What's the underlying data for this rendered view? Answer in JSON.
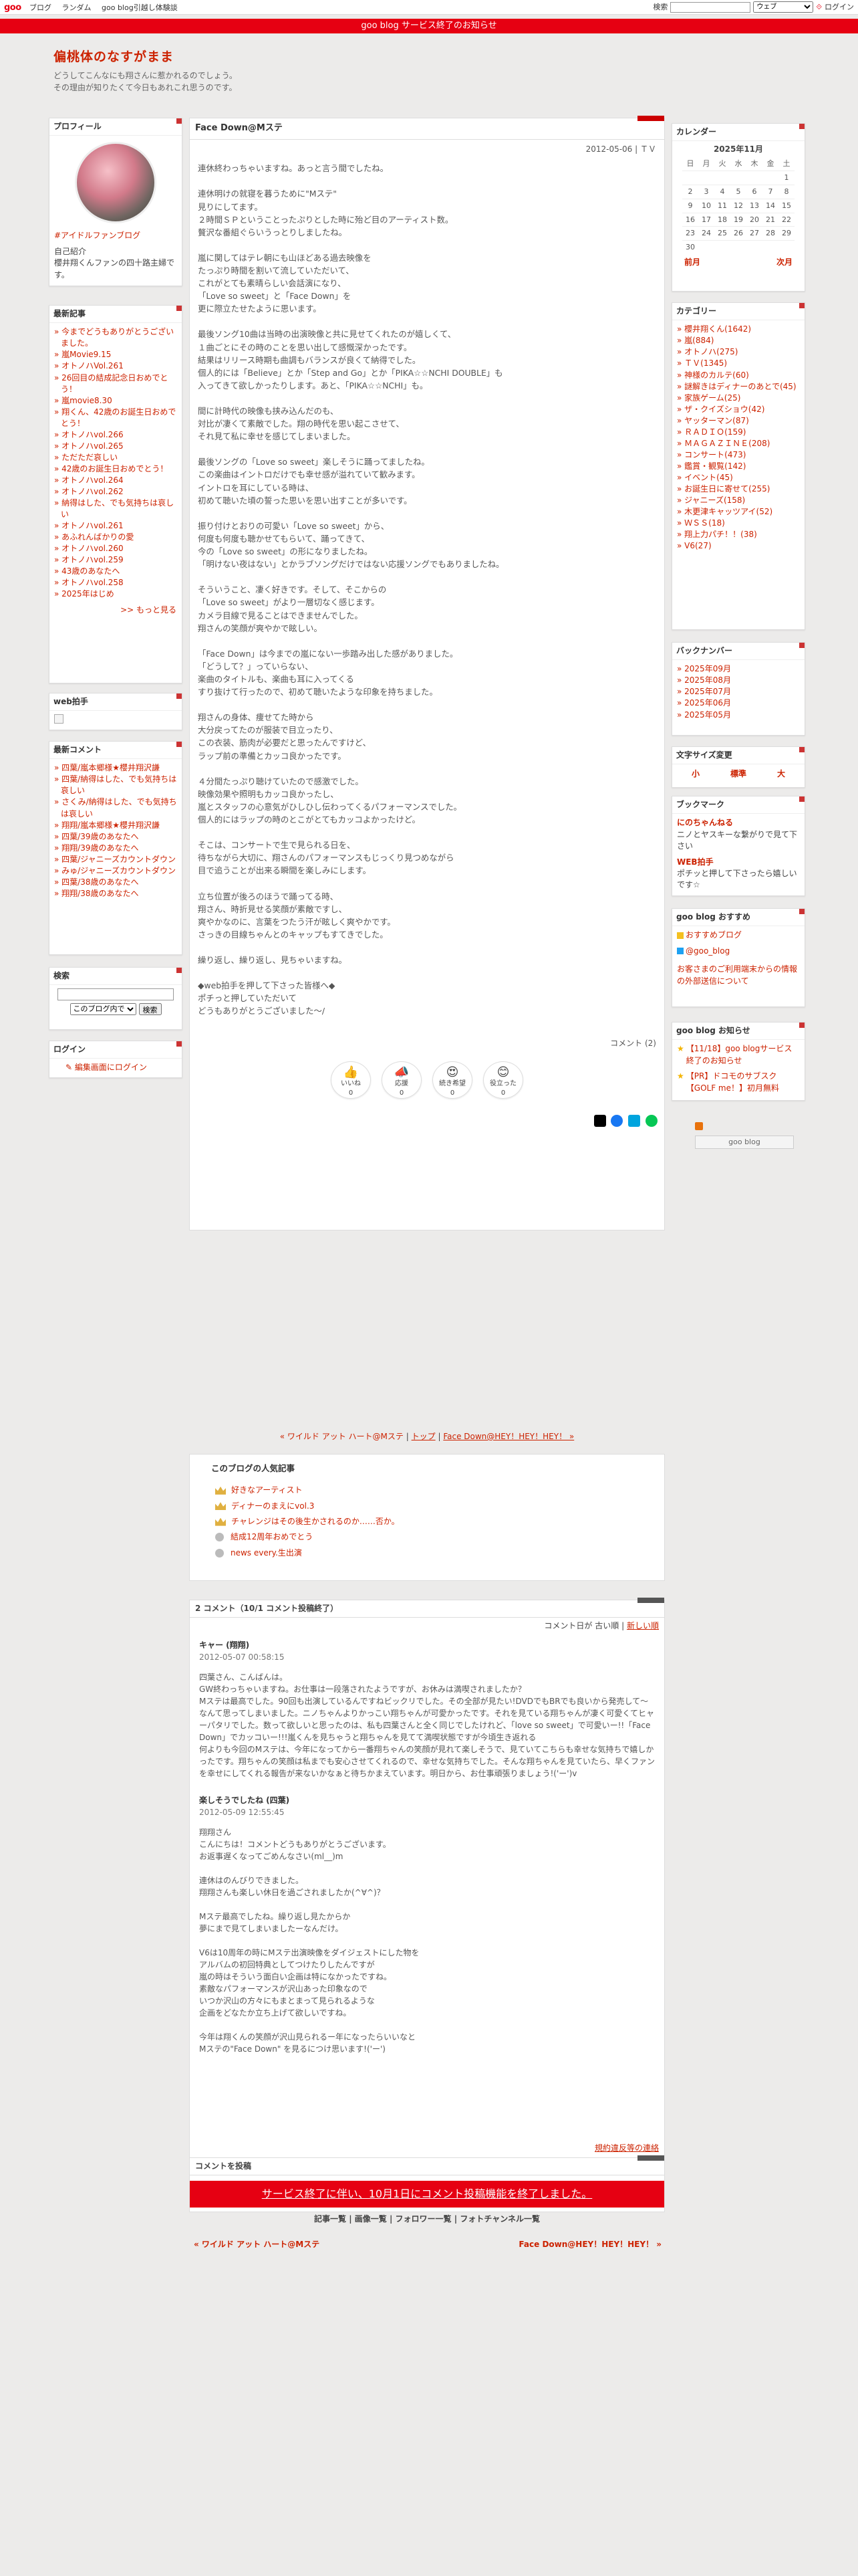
{
  "topbar": {
    "logo": "goo",
    "nav": [
      "ブログ",
      "ランダム",
      "goo blog引越し体験談"
    ],
    "search_label": "検索",
    "search_select": "ウェブ",
    "login": "ログイン"
  },
  "notice": "goo blog サービス終了のお知らせ",
  "header": {
    "title": "偏桃体のなすがまま",
    "desc1": "どうしてこんなにも翔さんに惹かれるのでしょう。",
    "desc2": "その理由が知りたくて今日もあれこれ思うのです。"
  },
  "profile": {
    "heading": "プロフィール",
    "link": "#アイドルファンブログ",
    "intro_label": "自己紹介",
    "intro": "櫻井翔くんファンの四十路主婦です。"
  },
  "recent": {
    "heading": "最新記事",
    "items": [
      "今までどうもありがとうございました。",
      "嵐Movie9.15",
      "オトノハVol.261",
      "26回目の結成記念日おめでとう！",
      "嵐movie8.30",
      "翔くん、42歳のお誕生日おめでとう！",
      "オトノハvol.266",
      "オトノハvol.265",
      "ただただ哀しい",
      "42歳のお誕生日おめでとう！",
      "オトノハvol.264",
      "オトノハvol.262",
      "納得はした、でも気持ちは哀しい",
      "オトノハvol.261",
      "あふれんばかりの愛",
      "オトノハvol.260",
      "オトノハvol.259",
      "43歳のあなたへ",
      "オトノハvol.258",
      "2025年はじめ"
    ],
    "more": ">> もっと見る"
  },
  "webtecho": {
    "heading": "web拍手"
  },
  "comments_recent": {
    "heading": "最新コメント",
    "items": [
      "四葉/嵐本郷様★櫻井翔沢謙",
      "四葉/納得はした、でも気持ちは哀しい",
      "さくみ/納得はした、でも気持ちは哀しい",
      "翔翔/嵐本郷様★櫻井翔沢謙",
      "四葉/39歳のあなたへ",
      "翔翔/39歳のあなたへ",
      "四葉/ジャニーズカウントダウン",
      "みゅ/ジャニーズカウントダウン",
      "四葉/38歳のあなたへ",
      "翔翔/38歳のあなたへ"
    ]
  },
  "search": {
    "heading": "検索",
    "select": "このブログ内で",
    "button": "検索"
  },
  "login": {
    "heading": "ログイン",
    "link": "編集画面にログイン"
  },
  "entry": {
    "title": "Face Down@Mステ",
    "date": "2012-05-06 | ＴＶ",
    "body": "連休終わっちゃいますね。あっと言う間でしたね。\n\n連休明けの就寝を暮うために\"Mステ\"\n見りにしてます。\n２時間ＳＰということったぷりとした時に殆ど目のアーティスト数。\n贅沢な番組ぐらいうっとりしましたね。\n\n嵐に関してはテレ朝にも山ほどある過去映像を\nたっぷり時間を割いて流していただいて、\nこれがとても素晴らしい会話演になり、\n「Love so sweet」と「Face Down」を\n更に際立たせたように思います。\n\n最後ソング10曲は当時の出演映像と共に見せてくれたのが嬉しくて、\n１曲ごとにその時のことを思い出して感慨深かったです。\n結果はリリース時期も曲調もバランスが良くて納得でした。\n個人的には「Believe」とか「Step and Go」とか「PIKA☆☆NCHI DOUBLE」も\n入ってきて欲しかったりします。あと、「PIKA☆☆NCHI」も。\n\n間に計時代の映像も挟み込んだのも、\n対比が凄くて素敵でした。翔の時代を思い起こさせて、\nそれ見て私に幸せを感じてしまいました。\n\n最後ソングの「Love so sweet」楽しそうに踊ってましたね。\nこの楽曲はイントロだけでも幸せ感が溢れていて歓みます。\nイントロを耳にしている時は、\n初めて聴いた頃の誓った思いを思い出すことが多いです。\n\n振り付けとおりの可愛い「Love so sweet」から、\n何度も何度も聴かせてもらいて、踊ってきて、\n今の「Love so sweet」の形になりましたね。\n「明けない夜はない」とかラブソングだけではない応援ソングでもありましたね。\n\nそういうこと、凄く好きです。そして、そこからの\n「Love so sweet」がより一層切なく感じます。\nカメラ目線で見ることはできませんでした。\n翔さんの笑顔が爽やかで眩しい。\n\n「Face Down」は今までの嵐にない一歩踏み出した感がありました。\n「どうして？」っていらない、\n楽曲のタイトルも、楽曲も耳に入ってくる\nすり抜けて行ったので、初めて聴いたような印象を持ちました。\n\n翔さんの身体、痩せてた時から\n大分戻ってたのが服装で目立ったり、\nこの衣装、筋肉が必要だと思ったんですけど、\nラップ前の準備とカッコ良かったです。\n\n４分間たっぷり聴けていたので感激でした。\n映像効果や照明もカッコ良かったし、\n嵐とスタッフの心意気がひしひし伝わってくるパフォーマンスでした。\n個人的にはラップの時のとこがとてもカッコよかったけど。\n\nそこは、コンサートで生で見られる日を、\n待ちながら大切に、翔さんのパフォーマンスもじっくり見つめながら\n目で追うことが出来る瞬間を楽しみにします。\n\n立ち位置が後ろのほうで踊ってる時、\n翔さん、時折見せる笑顔が素敵ですし、\n爽やかなのに、言葉をつたう汗が眩しく爽やかです。\nさっきの目線ちゃんとのキャップもすてきでした。\n\n繰り返し、繰り返し、見ちゃいますね。\n\n◆web拍手を押して下さった皆様へ◆\nポチっと押していただいて\nどうもありがとうございました〜/",
    "comment_count": "コメント (2)",
    "reactions": [
      {
        "label": "いいね",
        "count": "0",
        "emoji": "👍"
      },
      {
        "label": "応援",
        "count": "0",
        "emoji": "📣"
      },
      {
        "label": "続き希望",
        "count": "0",
        "emoji": "😍"
      },
      {
        "label": "役立った",
        "count": "0",
        "emoji": "😊"
      }
    ]
  },
  "pager": {
    "prev": "« ワイルド アット ハート@Mステ",
    "sep1": "|",
    "top": "トップ",
    "sep2": "|",
    "next": "Face Down@HEY！HEY！HEY！ »"
  },
  "popular": {
    "heading": "このブログの人気記事",
    "items": [
      "好きなアーティスト",
      "ディナーのまえにvol.3",
      "チャレンジはその後生かされるのか……否か。",
      "結成12周年おめでとう",
      "news every.生出演"
    ]
  },
  "comments": {
    "heading": "2 コメント（10/1 コメント投稿終了）",
    "sort_label": "コメント日が",
    "old": "古い順",
    "sep": "|",
    "new": "新しい順",
    "items": [
      {
        "name": "キャー (翔翔)",
        "date": "2012-05-07 00:58:15",
        "text": "四葉さん、こんばんは。\nGW終わっちゃいますね。お仕事は一段落されたようですが、お休みは満喫されましたか？\nMステは最高でした。90回も出演しているんですねビックリでした。その全部が見たい!DVDでもBRでも良いから発売して〜なんて思ってしまいました。ニノちゃんよりかっこい翔ちゃんが可愛かったです。それを見ている翔ちゃんが凄く可愛くてヒャーパタリでした。数って欲しいと思ったのは、私も四葉さんと全く同じでしたけれど、「love so sweet」で可愛いー!!「Face Down」でカッコいー!!!嵐くんを見ちゃうと翔ちゃんを見てて満喫状態ですが今頃生き返れる\n何よりも今回のMステは、今年になってから一番翔ちゃんの笑顔が見れて楽しそうで、見ていてこちらも幸せな気持ちで嬉しかったです。翔ちゃんの笑顔は私までも安心させてくれるので、幸せな気持ちでした。そんな翔ちゃんを見ていたら、早くファンを幸せにしてくれる報告が来ないかなぁと待ちかまえています。明日から、お仕事頑張りましょう!('ー')v"
      },
      {
        "name": "楽しそうでしたね (四葉)",
        "date": "2012-05-09 12:55:45",
        "text": "翔翔さん\nこんにちは！コメントどうもありがとうございます。\nお返事遅くなってごめんなさい(ml__)m\n\n連休はのんびりできました。\n翔翔さんも楽しい休日を過ごされましたか(^∀^)？\n\nMステ最高でしたね。繰り返し見たからか\n夢にまで見てしまいましたーなんだけ。\n\nV6は10周年の時にMステ出演映像をダイジェストにした物を\nアルバムの初回特典としてつけたりしたんですが\n嵐の時はそういう面白い企画は特になかったですね。\n素敵なパフォーマンスが沢山あった印象なので\nいつか沢山の方々にもまとまって見られるような\n企画をどなたか立ち上げて欲しいですね。\n\n今年は翔くんの笑顔が沢山見られるー年になったらいいなと\nMステの\"Face Down\" を見るにつけ思います!('ー')"
      }
    ],
    "report": "規約違反等の連絡"
  },
  "post": {
    "heading": "コメントを投稿",
    "banner": "サービス終了に伴い、10月1日にコメント投稿機能を終了しました。"
  },
  "footer_links": [
    "記事一覧",
    "画像一覧",
    "フォロワー一覧",
    "フォトチャンネル一覧"
  ],
  "footer_prev": "« ワイルド アット ハート@Mステ",
  "footer_next": "Face Down@HEY！HEY！HEY！ »",
  "calendar": {
    "heading": "カレンダー",
    "month": "2025年11月",
    "dow": [
      "日",
      "月",
      "火",
      "水",
      "木",
      "金",
      "土"
    ],
    "prev": "前月",
    "next": "次月"
  },
  "category": {
    "heading": "カテゴリー",
    "items": [
      "櫻井翔くん(1642)",
      "嵐(884)",
      "オトノハ(275)",
      "ＴＶ(1345)",
      "神様のカルテ(60)",
      "謎解きはディナーのあとで(45)",
      "家族ゲーム(25)",
      "ザ・クイズショウ(42)",
      "ヤッターマン(87)",
      "ＲＡＤＩＯ(159)",
      "ＭＡＧＡＺＩＮＥ(208)",
      "コンサート(473)",
      "鑑賞・観覧(142)",
      "イベント(45)",
      "お誕生日に寄せて(255)",
      "ジャニーズ(158)",
      "木更津キャッツアイ(52)",
      "ＷＳＳ(18)",
      "翔上力パチ！！(38)",
      "V6(27)"
    ]
  },
  "backnumber": {
    "heading": "バックナンバー",
    "items": [
      "2025年09月",
      "2025年08月",
      "2025年07月",
      "2025年06月",
      "2025年05月"
    ]
  },
  "fontsize": {
    "heading": "文字サイズ変更",
    "small": "小",
    "medium": "標準",
    "large": "大"
  },
  "bookmark": {
    "heading": "ブックマーク",
    "items": [
      {
        "t": "にのちゃんねる",
        "d": "ニノとヤスキーな繋がりで見て下さい"
      },
      {
        "t": "WEB拍手",
        "d": "ポチッと押して下さったら嬉しいです☆"
      }
    ]
  },
  "recommend": {
    "heading": "goo blog おすすめ",
    "items": [
      "おすすめブログ",
      "@goo_blog"
    ],
    "notice": "お客さまのご利用端末からの情報の外部送信について"
  },
  "oshirase": {
    "heading": "goo blog お知らせ",
    "items": [
      "【11/18】goo blogサービス終了のお知らせ",
      "【PR】ドコモのサブスク【GOLF me！】初月無料"
    ]
  },
  "goo_badge": "goo blog",
  "colors": {
    "accent": "#cc2200",
    "brand_red": "#e60012"
  }
}
